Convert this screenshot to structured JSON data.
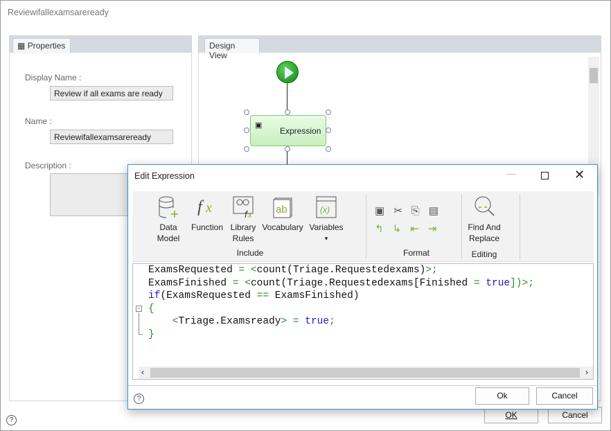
{
  "window": {
    "title": "Reviewifallexamsareready"
  },
  "properties": {
    "tab_label": "Properties",
    "display_name_label": "Display Name :",
    "display_name_value": "Review if all exams are ready",
    "name_label": "Name :",
    "name_value": "Reviewifallexamsareready",
    "description_label": "Description :",
    "description_value": ""
  },
  "design_view": {
    "tab_label": "Design View",
    "node_label": "Expression",
    "start_icon": "play-icon"
  },
  "dialog": {
    "title": "Edit Expression",
    "include": {
      "group_label": "Include",
      "items": [
        {
          "label1": "Data",
          "label2": "Model",
          "icon": "database-add-icon"
        },
        {
          "label1": "Function",
          "label2": "",
          "icon": "function-icon"
        },
        {
          "label1": "Library",
          "label2": "Rules",
          "icon": "library-rules-icon"
        },
        {
          "label1": "Vocabulary",
          "label2": "",
          "icon": "vocabulary-icon"
        },
        {
          "label1": "Variables",
          "label2": "▾",
          "icon": "variables-icon"
        }
      ]
    },
    "format": {
      "group_label": "Format"
    },
    "editing": {
      "group_label": "Editing",
      "item_label1": "Find And",
      "item_label2": "Replace"
    },
    "code_lines": [
      "ExamsRequested = <count(Triage.Requestedexams)>;",
      "ExamsFinished = <count(Triage.Requestedexams[Finished = true])>;",
      "if(ExamsRequested == ExamsFinished)",
      "{",
      "    <Triage.Examsready> = true;",
      "}"
    ],
    "ok_label": "Ok",
    "cancel_label": "Cancel"
  },
  "footer": {
    "ok_label": "OK",
    "cancel_label": "Cancel"
  },
  "colors": {
    "accent": "#3c8fd8",
    "keyword": "#1a1ac8",
    "operator": "#2a8a2a",
    "node_fill": "#d8f5d0"
  }
}
